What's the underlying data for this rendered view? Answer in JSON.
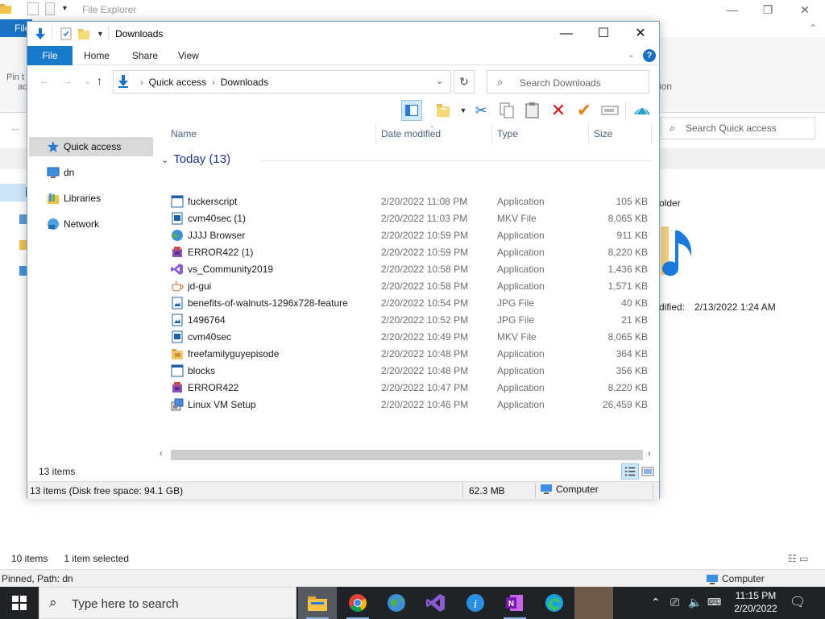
{
  "background_window": {
    "title": "File Explorer",
    "file_tab": "File",
    "pin_text": "Pin t",
    "pin_text2": "ac",
    "ion_text": "ion",
    "search_placeholder": "Search Quick access",
    "folder_label": "older",
    "modified_label": "dified:",
    "modified_value": "2/13/2022 1:24 AM",
    "status_items": "10 items",
    "status_selected": "1 item selected",
    "pinned_path": "Pinned, Path: dn",
    "computer": "Computer",
    "status_items_under": "10 items"
  },
  "window": {
    "title": "Downloads",
    "ribbon_tabs": [
      "File",
      "Home",
      "Share",
      "View"
    ],
    "help": "?"
  },
  "navigation": {
    "breadcrumb": [
      "Quick access",
      "Downloads"
    ],
    "search_placeholder": "Search Downloads"
  },
  "toolbar": {
    "icons": [
      "preview-pane-icon",
      "new-folder-icon",
      "cut-icon",
      "copy-icon",
      "paste-icon",
      "delete-icon",
      "properties-check-icon",
      "rename-icon",
      "shell-icon"
    ]
  },
  "nav_pane": {
    "items": [
      {
        "label": "Quick access",
        "icon": "star-icon",
        "selected": true
      },
      {
        "label": "dn",
        "icon": "monitor-icon",
        "selected": false
      },
      {
        "label": "Libraries",
        "icon": "libraries-icon",
        "selected": false
      },
      {
        "label": "Network",
        "icon": "network-icon",
        "selected": false
      }
    ]
  },
  "file_list": {
    "columns": [
      "Name",
      "Date modified",
      "Type",
      "Size"
    ],
    "group": "Today (13)",
    "rows": [
      {
        "name": "fuckerscript",
        "date": "2/20/2022 11:08 PM",
        "type": "Application",
        "size": "105 KB",
        "icon": "app-window-icon"
      },
      {
        "name": "cvm40sec (1)",
        "date": "2/20/2022 11:03 PM",
        "type": "MKV File",
        "size": "8,065 KB",
        "icon": "video-file-icon"
      },
      {
        "name": "JJJJ Browser",
        "date": "2/20/2022 10:59 PM",
        "type": "Application",
        "size": "911 KB",
        "icon": "globe-icon"
      },
      {
        "name": "ERROR422 (1)",
        "date": "2/20/2022 10:59 PM",
        "type": "Application",
        "size": "8,220 KB",
        "icon": "installer-box-icon"
      },
      {
        "name": "vs_Community2019",
        "date": "2/20/2022 10:58 PM",
        "type": "Application",
        "size": "1,436 KB",
        "icon": "visual-studio-icon"
      },
      {
        "name": "jd-gui",
        "date": "2/20/2022 10:58 PM",
        "type": "Application",
        "size": "1,571 KB",
        "icon": "coffee-cup-icon"
      },
      {
        "name": "benefits-of-walnuts-1296x728-feature",
        "date": "2/20/2022 10:54 PM",
        "type": "JPG File",
        "size": "40 KB",
        "icon": "image-file-icon"
      },
      {
        "name": "1496764",
        "date": "2/20/2022 10:52 PM",
        "type": "JPG File",
        "size": "21 KB",
        "icon": "image-file-icon"
      },
      {
        "name": "cvm40sec",
        "date": "2/20/2022 10:49 PM",
        "type": "MKV File",
        "size": "8,065 KB",
        "icon": "video-file-icon"
      },
      {
        "name": "freefamilyguyepisode",
        "date": "2/20/2022 10:48 PM",
        "type": "Application",
        "size": "364 KB",
        "icon": "folder-app-icon"
      },
      {
        "name": "blocks",
        "date": "2/20/2022 10:48 PM",
        "type": "Application",
        "size": "356 KB",
        "icon": "app-window-icon"
      },
      {
        "name": "ERROR422",
        "date": "2/20/2022 10:47 PM",
        "type": "Application",
        "size": "8,220 KB",
        "icon": "installer-box-icon"
      },
      {
        "name": "Linux VM Setup",
        "date": "2/20/2022 10:46 PM",
        "type": "Application",
        "size": "26,459 KB",
        "icon": "setup-icon"
      }
    ]
  },
  "status": {
    "inner_count": "13 items",
    "outer_left": "13 items (Disk free space: 94.1 GB)",
    "outer_size": "62.3 MB",
    "outer_location": "Computer"
  },
  "taskbar": {
    "search_text": "Type here to search",
    "time": "11:15 PM",
    "date": "2/20/2022",
    "apps": [
      "file-explorer-icon",
      "chrome-icon",
      "globe-icon",
      "visual-studio-icon",
      "info-icon",
      "onenote-icon",
      "edge-icon",
      "blank-app-icon"
    ]
  }
}
